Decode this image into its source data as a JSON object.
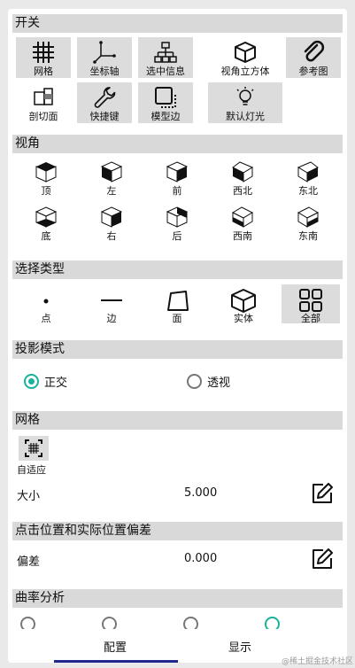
{
  "switches": {
    "title": "开关",
    "items": [
      {
        "label": "网格",
        "icon": "grid-icon",
        "active": true
      },
      {
        "label": "坐标轴",
        "icon": "axis-icon",
        "active": true
      },
      {
        "label": "选中信息",
        "icon": "hierarchy-icon",
        "active": true
      },
      {
        "label": "视角立方体",
        "icon": "view-cube-icon",
        "active": false
      },
      {
        "label": "参考图",
        "icon": "paperclip-icon",
        "active": true
      },
      {
        "label": "剖切面",
        "icon": "section-plane-icon",
        "active": false
      },
      {
        "label": "快捷键",
        "icon": "wrench-icon",
        "active": true
      },
      {
        "label": "模型边",
        "icon": "model-edge-icon",
        "active": true
      },
      {
        "label": "默认灯光",
        "icon": "light-bulb-icon",
        "active": true
      }
    ]
  },
  "views": {
    "title": "视角",
    "items": [
      "顶",
      "左",
      "前",
      "西北",
      "东北",
      "底",
      "右",
      "后",
      "西南",
      "东南"
    ]
  },
  "select_type": {
    "title": "选择类型",
    "items": [
      {
        "label": "点",
        "icon": "point-icon",
        "active": false
      },
      {
        "label": "边",
        "icon": "edge-icon",
        "active": false
      },
      {
        "label": "面",
        "icon": "face-icon",
        "active": false
      },
      {
        "label": "实体",
        "icon": "solid-icon",
        "active": false
      },
      {
        "label": "全部",
        "icon": "all-icon",
        "active": true
      }
    ]
  },
  "projection": {
    "title": "投影模式",
    "options": [
      {
        "label": "正交",
        "selected": true
      },
      {
        "label": "透视",
        "selected": false
      }
    ]
  },
  "grid": {
    "title": "网格",
    "adaptive_label": "自适应",
    "size_label": "大小",
    "size_value": "5.000"
  },
  "offset": {
    "title": "点击位置和实际位置偏差",
    "label": "偏差",
    "value": "0.000"
  },
  "curvature": {
    "title": "曲率分析"
  },
  "tabs": {
    "config": "配置",
    "display": "显示",
    "active": "config"
  },
  "watermark": "@稀土掘金技术社区",
  "colors": {
    "accent": "#19b39b",
    "tab_indicator": "#1f2a8c",
    "section_header": "#d9d9d9",
    "active_tile": "#dcdcdc"
  }
}
